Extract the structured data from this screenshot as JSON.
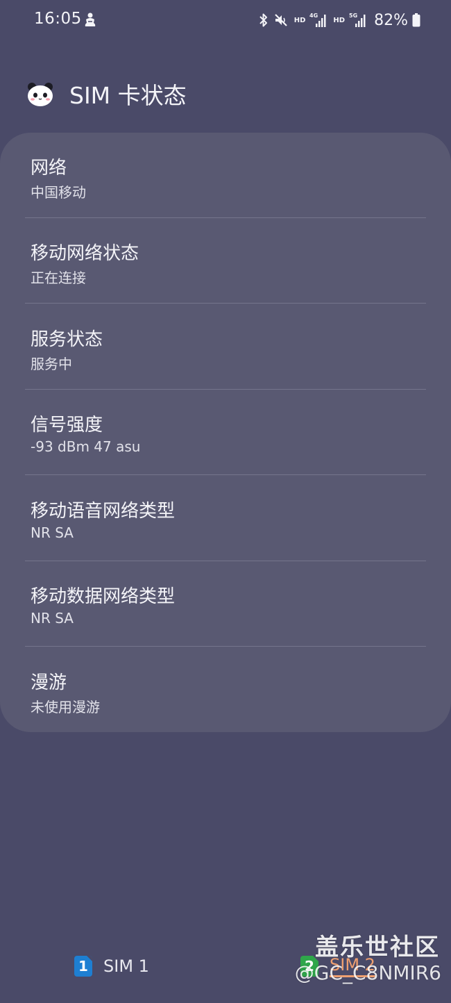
{
  "status_bar": {
    "time": "16:05",
    "hd_1": "HD",
    "net_1": "4G",
    "hd_2": "HD",
    "net_2": "5G",
    "battery": "82%",
    "icons": [
      "notification-person-icon",
      "bluetooth-icon",
      "mute-icon",
      "signal-4g-icon",
      "signal-5g-icon",
      "battery-icon"
    ]
  },
  "header": {
    "title": "SIM 卡状态",
    "avatar_icon": "panda-avatar-icon"
  },
  "rows": [
    {
      "title": "网络",
      "value": "中国移动"
    },
    {
      "title": "移动网络状态",
      "value": "正在连接"
    },
    {
      "title": "服务状态",
      "value": "服务中"
    },
    {
      "title": "信号强度",
      "value": "-93 dBm 47 asu"
    },
    {
      "title": "移动语音网络类型",
      "value": "NR SA"
    },
    {
      "title": "移动数据网络类型",
      "value": "NR SA"
    },
    {
      "title": "漫游",
      "value": "未使用漫游"
    }
  ],
  "tabs": {
    "sim1": {
      "badge": "1",
      "label": "SIM 1"
    },
    "sim2": {
      "badge": "2",
      "label": "SIM 2",
      "selected": true
    }
  },
  "watermark": {
    "line1": "盖乐世社区",
    "line2": "@GC_C8NMIR6"
  },
  "colors": {
    "background": "#4a4a68",
    "card": "#595972",
    "sim1_badge": "#1e7fd2",
    "sim2_badge": "#2fa64a",
    "selected_tab": "#f0a070"
  }
}
